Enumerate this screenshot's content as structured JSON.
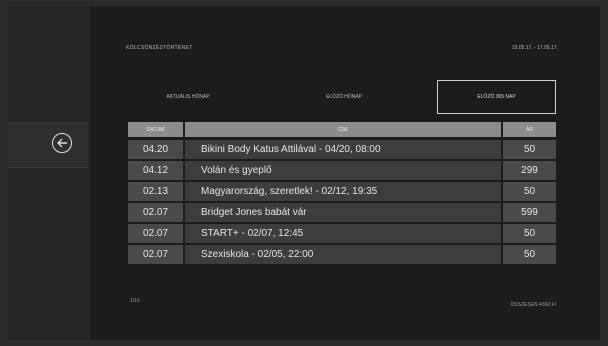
{
  "header": {
    "title": "KÖLCSÖNZÉSTÖRTÉNET",
    "date_range": "15.05.17. - 17.05.17."
  },
  "tabs": [
    {
      "label": "AKTUÁLIS HÓNAP",
      "active": false
    },
    {
      "label": "ELŐZŐ HÓNAP",
      "active": false
    },
    {
      "label": "ELŐZŐ 365 NAP",
      "active": true
    }
  ],
  "table": {
    "headers": {
      "date": "DÁTUM",
      "title": "CÍM",
      "price": "ÁR"
    },
    "rows": [
      {
        "date": "04.20",
        "title": "Bikini Body Katus Attilával - 04/20, 08:00",
        "price": "50"
      },
      {
        "date": "04.12",
        "title": "Volán és gyeplő",
        "price": "299"
      },
      {
        "date": "02.13",
        "title": "Magyarország, szeretlek! - 02/12, 19:35",
        "price": "50"
      },
      {
        "date": "02.07",
        "title": "Bridget Jones babát vár",
        "price": "599"
      },
      {
        "date": "02.07",
        "title": "START+ - 02/07, 12:45",
        "price": "50"
      },
      {
        "date": "02.07",
        "title": "Szexiskola - 02/05, 22:00",
        "price": "50"
      }
    ]
  },
  "footer": {
    "page_indicator": "1/16",
    "total": "ÖSSZESEN 4392 Ft"
  },
  "icons": {
    "back": "arrow-left-circle-icon"
  }
}
